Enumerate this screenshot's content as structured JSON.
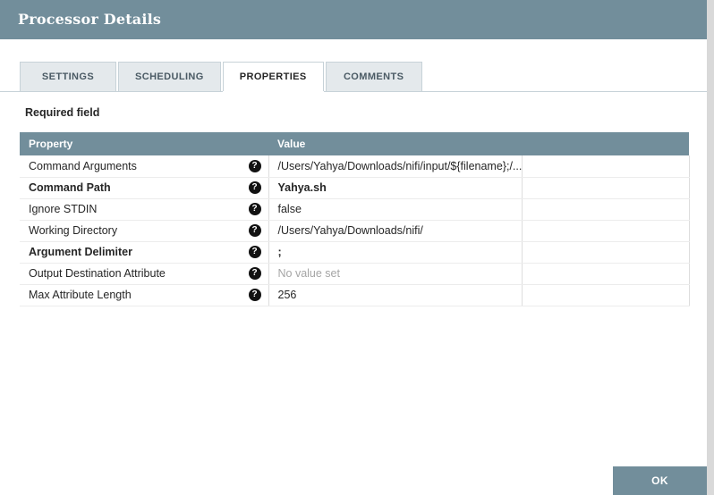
{
  "dialog": {
    "title": "Processor Details",
    "required_field_label": "Required field",
    "ok_label": "OK"
  },
  "tabs": [
    {
      "label": "SETTINGS"
    },
    {
      "label": "SCHEDULING"
    },
    {
      "label": "PROPERTIES"
    },
    {
      "label": "COMMENTS"
    }
  ],
  "active_tab": "PROPERTIES",
  "table": {
    "columns": {
      "property": "Property",
      "value": "Value"
    },
    "help_glyph": "?",
    "rows": [
      {
        "property": "Command Arguments",
        "value": "/Users/Yahya/Downloads/nifi/input/${filename};/...",
        "required": false,
        "highlighted": false,
        "unset": false
      },
      {
        "property": "Command Path",
        "value": "Yahya.sh",
        "required": true,
        "highlighted": false,
        "unset": false
      },
      {
        "property": "Ignore STDIN",
        "value": "false",
        "required": false,
        "highlighted": true,
        "unset": false
      },
      {
        "property": "Working Directory",
        "value": "/Users/Yahya/Downloads/nifi/",
        "required": false,
        "highlighted": false,
        "unset": false
      },
      {
        "property": "Argument Delimiter",
        "value": ";",
        "required": true,
        "highlighted": false,
        "unset": false
      },
      {
        "property": "Output Destination Attribute",
        "value": "No value set",
        "required": false,
        "highlighted": false,
        "unset": true
      },
      {
        "property": "Max Attribute Length",
        "value": "256",
        "required": false,
        "highlighted": false,
        "unset": false
      }
    ]
  },
  "colors": {
    "accent": "#728e9b",
    "highlight_row": "#fcf6dd",
    "alt_row": "#f4f4f4",
    "unset_text": "#a5a5a5"
  }
}
